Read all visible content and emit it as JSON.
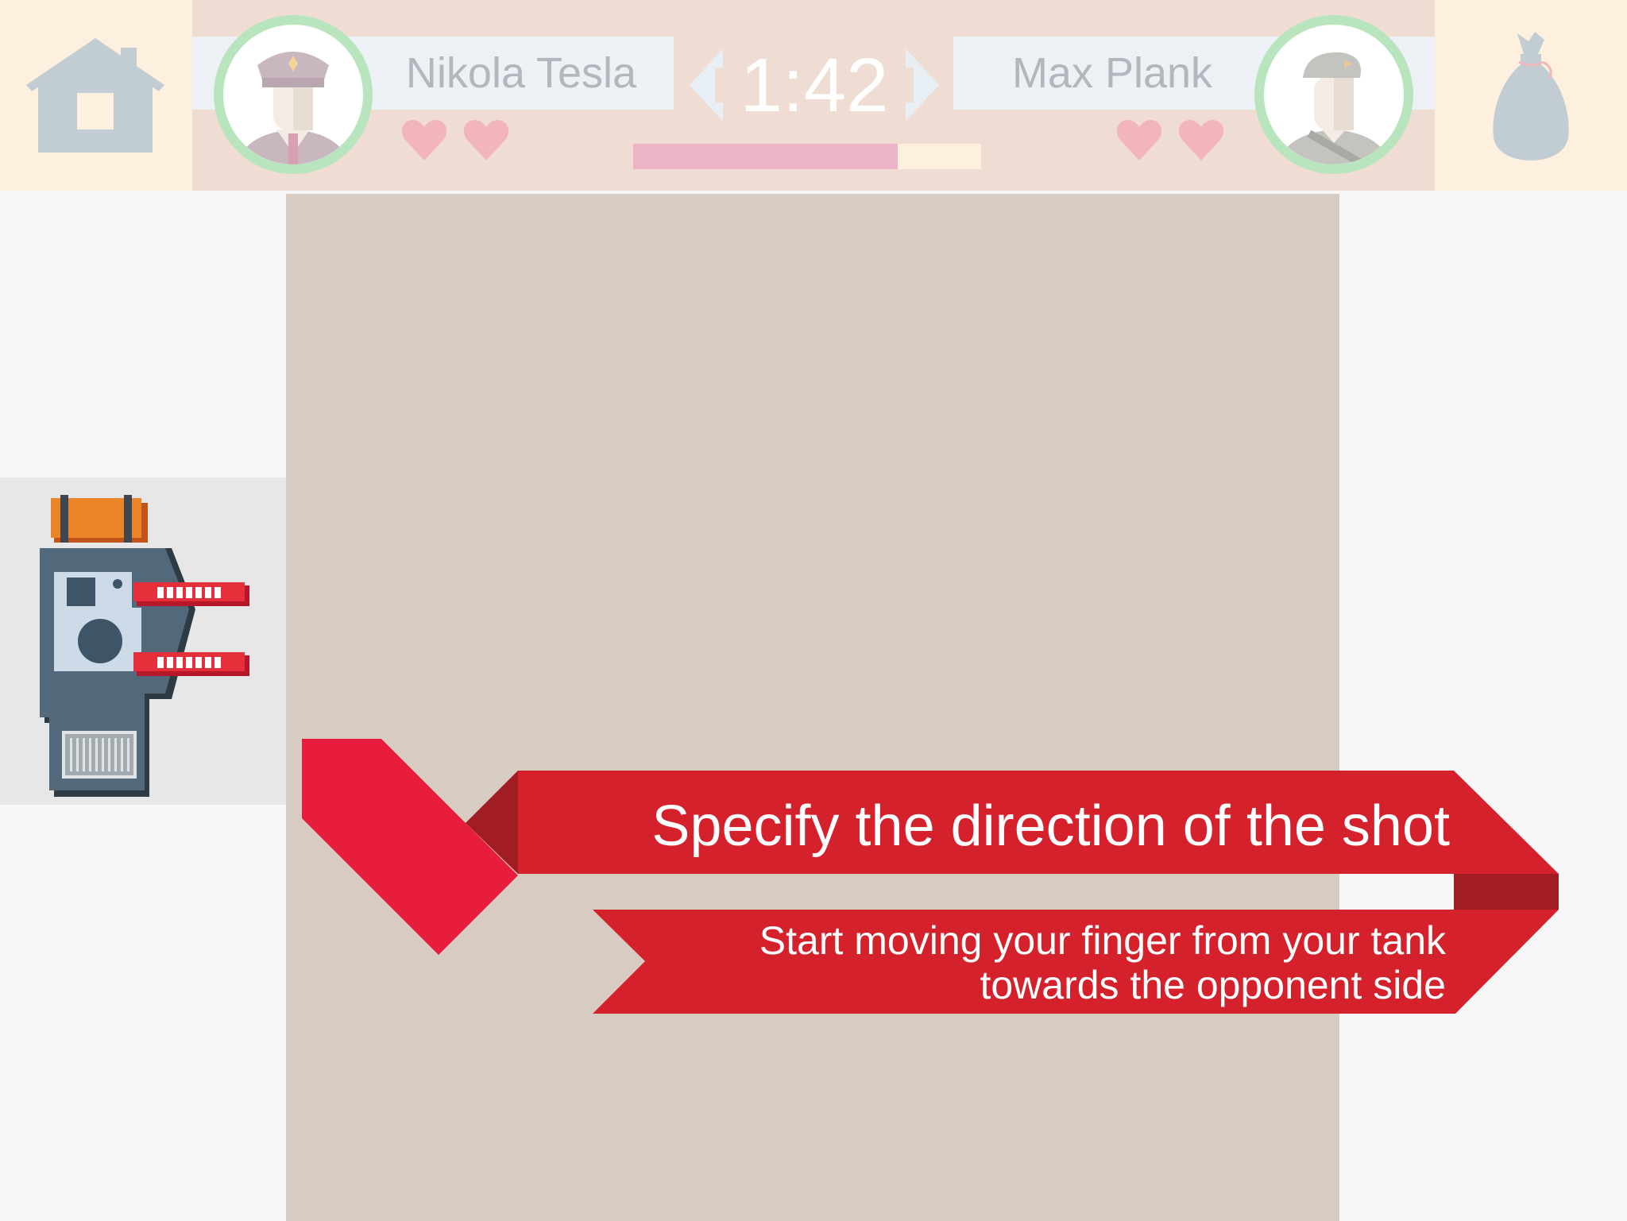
{
  "hud": {
    "home_icon": "house-icon",
    "bag_icon": "money-bag-icon",
    "timer": "1:42",
    "progress_fraction": 0.76,
    "player": {
      "name": "Nikola Tesla",
      "avatar": "officer-avatar",
      "lives": 2,
      "heart_icon": "heart-icon"
    },
    "opponent": {
      "name": "Max Plank",
      "avatar": "soldier-beret-avatar",
      "lives": 2,
      "heart_icon": "heart-icon"
    }
  },
  "tutorial": {
    "title": "Specify the direction of the shot",
    "line_1": "Start moving your finger from your tank",
    "line_2": "towards the opponent side"
  },
  "colors": {
    "ribbon_red": "#d4212b",
    "ribbon_dark": "#a11d23",
    "arrow_red": "#e81c3c",
    "hud_cream": "#fdf0df",
    "hud_pink": "#efdcd3",
    "board": "#d8cbc2",
    "avatar_ring": "#b8e5bd",
    "heart": "#f2b5bd",
    "progress_fill": "#edb4c8"
  }
}
